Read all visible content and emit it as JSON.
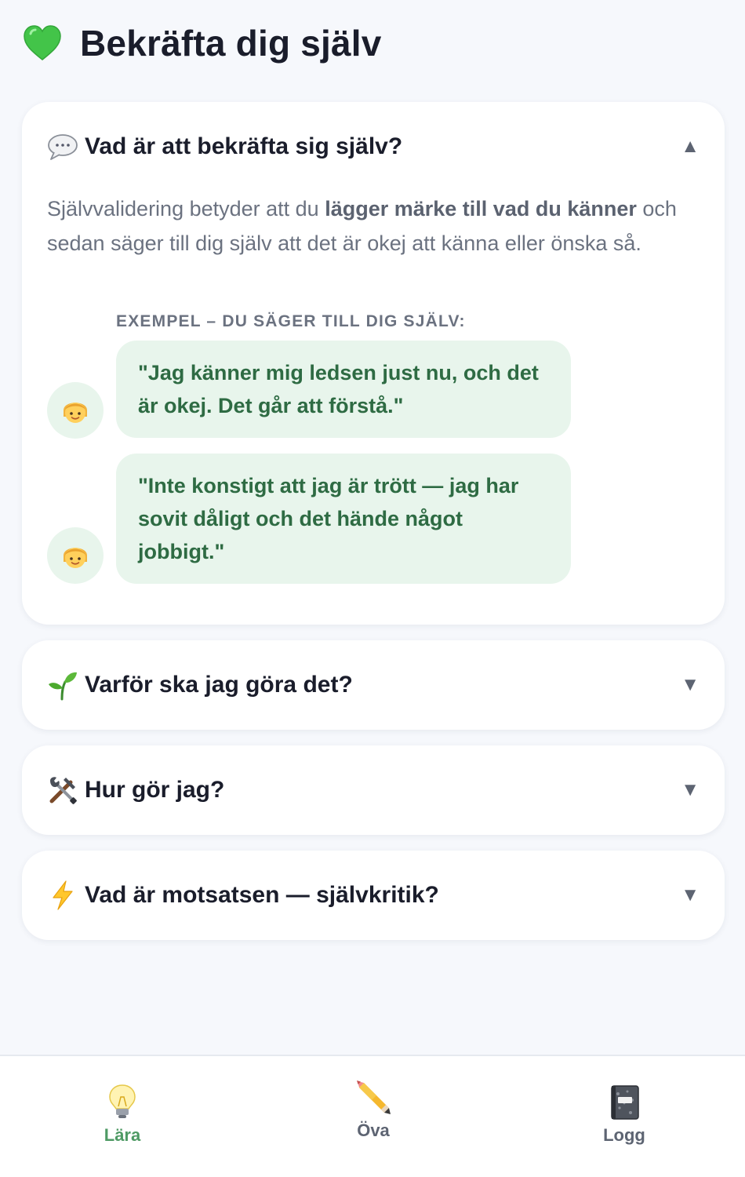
{
  "header": {
    "title": "Bekräfta dig själv",
    "icon": "green-heart-icon"
  },
  "sections": [
    {
      "title": "Vad är att bekräfta sig själv?",
      "icon": "speech-bubble-icon",
      "expanded": true,
      "chevron": "▲",
      "intro": {
        "before": "Självvalidering betyder att du ",
        "highlight": "lägger märke till vad du känner",
        "after": " och sedan säger till dig själv att det är okej att känna eller önska så."
      },
      "examples_label": "EXEMPEL – DU SÄGER TILL DIG SJÄLV:",
      "examples": [
        "\"Jag känner mig ledsen just nu, och det är okej. Det går att förstå.\"",
        "\"Inte konstigt att jag är trött — jag har sovit dåligt och det hände något jobbigt.\""
      ]
    },
    {
      "title": "Varför ska jag göra det?",
      "icon": "seedling-icon",
      "expanded": false,
      "chevron": "▼"
    },
    {
      "title": "Hur gör jag?",
      "icon": "tools-icon",
      "expanded": false,
      "chevron": "▼"
    },
    {
      "title": "Vad är motsatsen — självkritik?",
      "icon": "lightning-icon",
      "expanded": false,
      "chevron": "▼"
    }
  ],
  "nav": {
    "items": [
      {
        "label": "Lära",
        "icon": "lightbulb-icon",
        "active": true
      },
      {
        "label": "Öva",
        "icon": "pencil-icon",
        "active": false
      },
      {
        "label": "Logg",
        "icon": "notebook-icon",
        "active": false
      }
    ]
  },
  "colors": {
    "background": "#f6f8fc",
    "accent_green": "#2e6b43",
    "bubble_bg": "#e8f5ec",
    "nav_active": "#4e9a64",
    "nav_inactive": "#5d6472"
  }
}
